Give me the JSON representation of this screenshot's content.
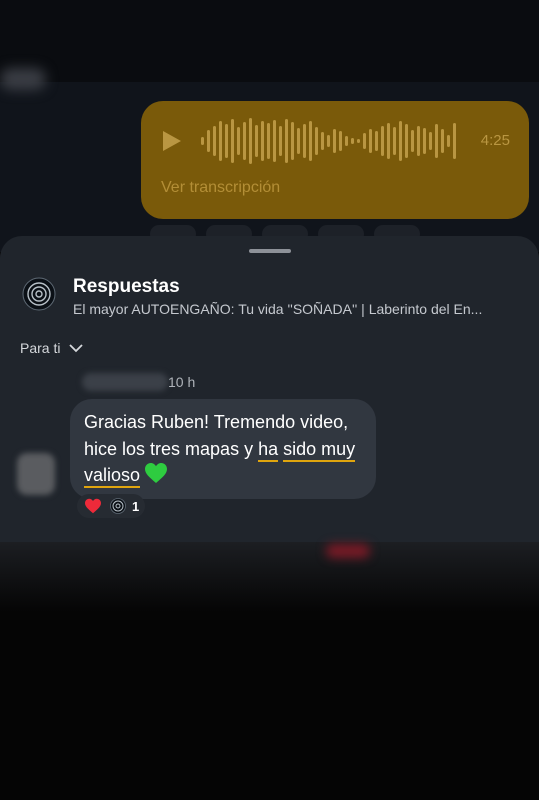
{
  "voice_message": {
    "duration": "4:25",
    "transcript_link": "Ver transcripción",
    "icon": "play-icon",
    "color": "#7a5a0a"
  },
  "sheet": {
    "title": "Respuestas",
    "subtitle": "El mayor AUTOENGAÑO: Tu vida ''SOÑADA'' | Laberinto del En...",
    "filter_label": "Para ti",
    "filter_icon": "chevron-down-icon",
    "logo_icon": "channel-logo-icon"
  },
  "comment": {
    "time": "10 h",
    "text_plain": "Gracias Ruben! Tremendo video, hice los tres mapas y ",
    "text_highlight_1": "ha",
    "text_highlight_2": "sido muy valioso",
    "emoji": "green-heart-icon",
    "highlight_color": "#e0a50e",
    "reactions": {
      "icons": [
        "red-heart-icon",
        "channel-logo-icon"
      ],
      "count": "1"
    }
  }
}
